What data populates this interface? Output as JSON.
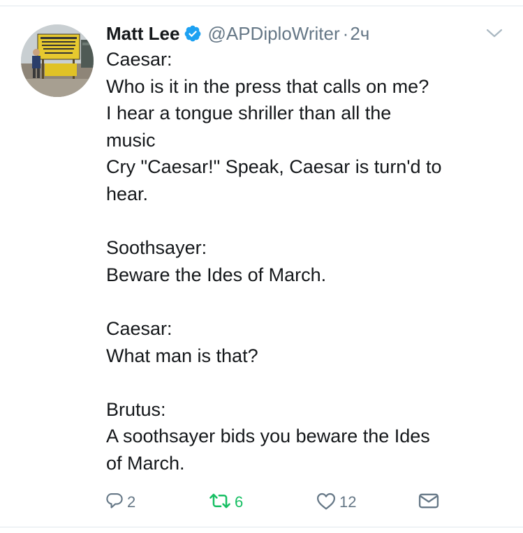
{
  "tweet": {
    "author": {
      "display_name": "Matt Lee",
      "handle": "@APDiploWriter",
      "verified": true
    },
    "separator": "·",
    "timestamp": "2ч",
    "lines": [
      "Caesar:",
      "Who is it in the press that calls on me?",
      "I hear a tongue shriller than all the",
      "music",
      "Cry \"Caesar!\" Speak, Caesar is turn'd to",
      "hear.",
      "",
      "Soothsayer:",
      "Beware the Ides of March.",
      "",
      "Caesar:",
      "What man is that?",
      "",
      "Brutus:",
      "A soothsayer bids you beware the Ides",
      "of March."
    ],
    "actions": {
      "reply_count": "2",
      "retweet_count": "6",
      "like_count": "12"
    }
  },
  "colors": {
    "text": "#14171a",
    "secondary": "#657786",
    "verified_blue": "#1da1f2",
    "retweet_green": "#17bf63",
    "divider": "#e1e8ed"
  },
  "icons": {
    "verified": "verified-badge-icon",
    "caret": "chevron-down-icon",
    "reply": "reply-icon",
    "retweet": "retweet-icon",
    "like": "heart-icon",
    "dm": "envelope-icon"
  }
}
